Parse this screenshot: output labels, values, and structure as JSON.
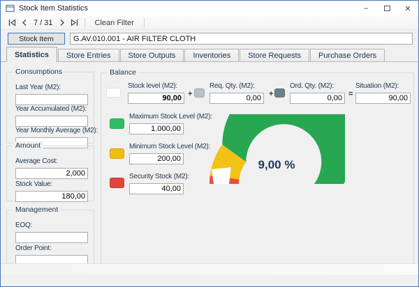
{
  "window": {
    "title": "Stock Item Statistics"
  },
  "icons": {
    "minimize": "–",
    "maximize": "square-outline",
    "close": "✕",
    "nav_first": "bar-triangle-left",
    "nav_prev": "chevron-left",
    "nav_next": "chevron-right",
    "nav_last": "triangle-right-bar",
    "app": "form-window"
  },
  "toolbar": {
    "record_counter": "7 / 31",
    "clean_filter_label": "Clean Filter"
  },
  "stock_item": {
    "button_label": "Stock Item",
    "value": "G.AV.010.001 - AIR FILTER CLOTH"
  },
  "tabs": [
    {
      "label": "Statistics",
      "active": true
    },
    {
      "label": "Store Entries",
      "active": false
    },
    {
      "label": "Store Outputs",
      "active": false
    },
    {
      "label": "Inventories",
      "active": false
    },
    {
      "label": "Store Requests",
      "active": false
    },
    {
      "label": "Purchase Orders",
      "active": false
    }
  ],
  "consumptions": {
    "title": "Consumptions",
    "fields": [
      {
        "label": "Last Year (M2):",
        "value": ""
      },
      {
        "label": "Year Accumulated (M2):",
        "value": ""
      },
      {
        "label": "Year Monthly Average (M2):",
        "value": ""
      }
    ]
  },
  "amount": {
    "title": "Amount",
    "fields": [
      {
        "label": "Average Cost:",
        "value": "2,000"
      },
      {
        "label": "Stock Value:",
        "value": "180,00"
      }
    ]
  },
  "management": {
    "title": "Management",
    "fields": [
      {
        "label": "EOQ:",
        "value": ""
      },
      {
        "label": "Order Point:",
        "value": ""
      }
    ]
  },
  "balance": {
    "title": "Balance",
    "equation": {
      "terms": [
        {
          "label": "Stock level (M2):",
          "value": "90,00",
          "swatch": "#ffffff"
        },
        {
          "label": "Req. Qty. (M2):",
          "value": "0,00",
          "swatch": "#b7c1c6"
        },
        {
          "label": "Ord. Qty. (M2):",
          "value": "0,00",
          "swatch": "#6d7f88"
        },
        {
          "label": "Situation (M2):",
          "value": "90,00"
        }
      ],
      "operators": [
        "+",
        "+",
        "="
      ]
    },
    "levels": [
      {
        "label": "Maximum Stock Level (M2):",
        "value": "1.000,00",
        "color": "#2ebd62"
      },
      {
        "label": "Minimum Stock  Level (M2):",
        "value": "200,00",
        "color": "#f0be10"
      },
      {
        "label": "Security Stock (M2):",
        "value": "40,00",
        "color": "#e2463a"
      }
    ]
  },
  "chart_data": {
    "type": "gauge",
    "value_percent": 9,
    "value_label": "9,00 %",
    "range_min": 0,
    "range_max": 100,
    "ranges": [
      {
        "from": 0,
        "to": 4,
        "color": "#e8503c"
      },
      {
        "from": 4,
        "to": 20,
        "color": "#f2c216"
      },
      {
        "from": 20,
        "to": 100,
        "color": "#28a652"
      }
    ],
    "marker_color": "#ffffff",
    "text_color": "#1f3864",
    "legend_position": "none",
    "grid": false
  }
}
